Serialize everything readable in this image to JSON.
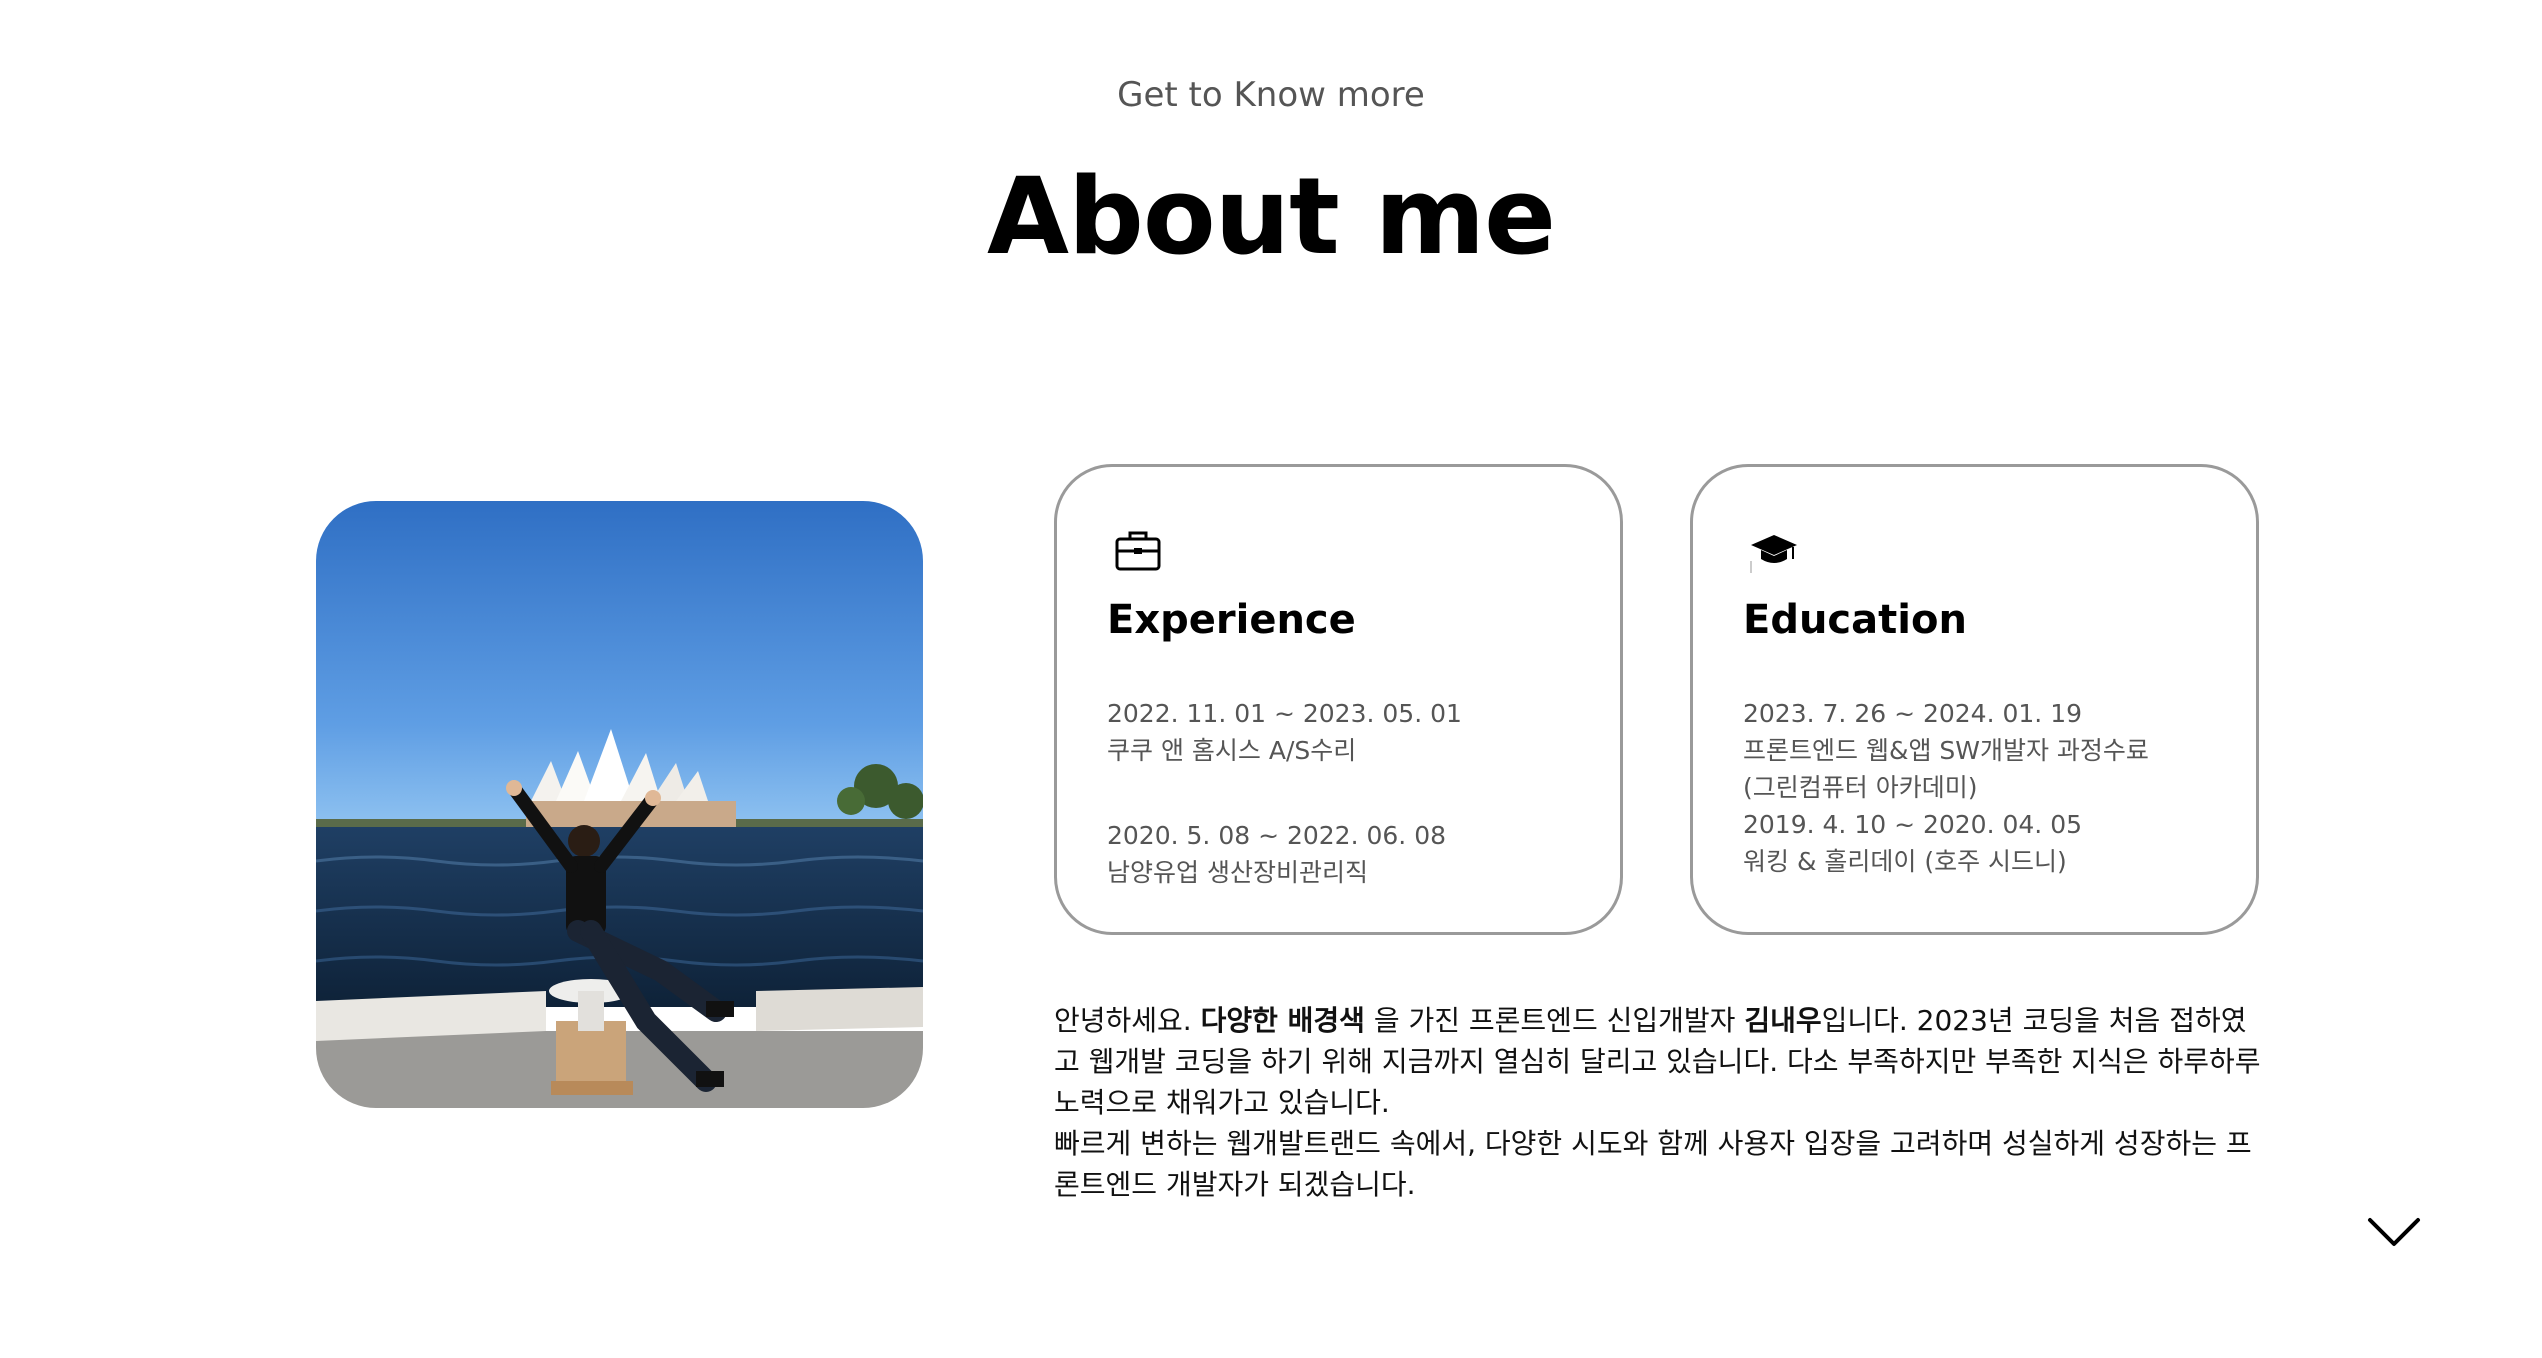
{
  "header": {
    "subtitle": "Get to Know more",
    "title": "About me"
  },
  "photo": {
    "alt_icon": "profile-photo"
  },
  "experience": {
    "icon": "briefcase-icon",
    "title": "Experience",
    "entries": [
      {
        "period": "2022. 11. 01 ~ 2023. 05. 01",
        "desc": "쿠쿠 앤 홈시스 A/S수리"
      },
      {
        "period": "2020. 5. 08 ~ 2022. 06. 08",
        "desc": "남양유업 생산장비관리직"
      }
    ]
  },
  "education": {
    "icon": "graduation-cap-icon",
    "title": "Education",
    "lines": [
      "2023. 7. 26 ~ 2024. 01. 19",
      "프론트엔드 웹&앱 SW개발자 과정수료",
      "(그린컴퓨터 아카데미)",
      "2019. 4. 10 ~ 2020. 04. 05",
      "워킹 & 홀리데이 (호주 시드니)"
    ]
  },
  "intro": {
    "p1_a": "안녕하세요. ",
    "p1_b": "다양한 배경색",
    "p1_c": " 을 가진 프론트엔드 신입개발자 ",
    "p1_d": "김내우",
    "p1_e": "입니다. 2023년 코딩을 처음 접하였고 웹개발 코딩을 하기 위해 지금까지 열심히 달리고 있습니다. 다소 부족하지만 부족한 지식은 하루하루 노력으로 채워가고 있습니다.",
    "p2": "빠르게 변하는 웹개발트랜드 속에서, 다양한 시도와 함께 사용자 입장을 고려하며 성실하게 성장하는 프론트엔드 개발자가 되겠습니다."
  },
  "nav": {
    "scroll_icon": "chevron-down-icon"
  }
}
